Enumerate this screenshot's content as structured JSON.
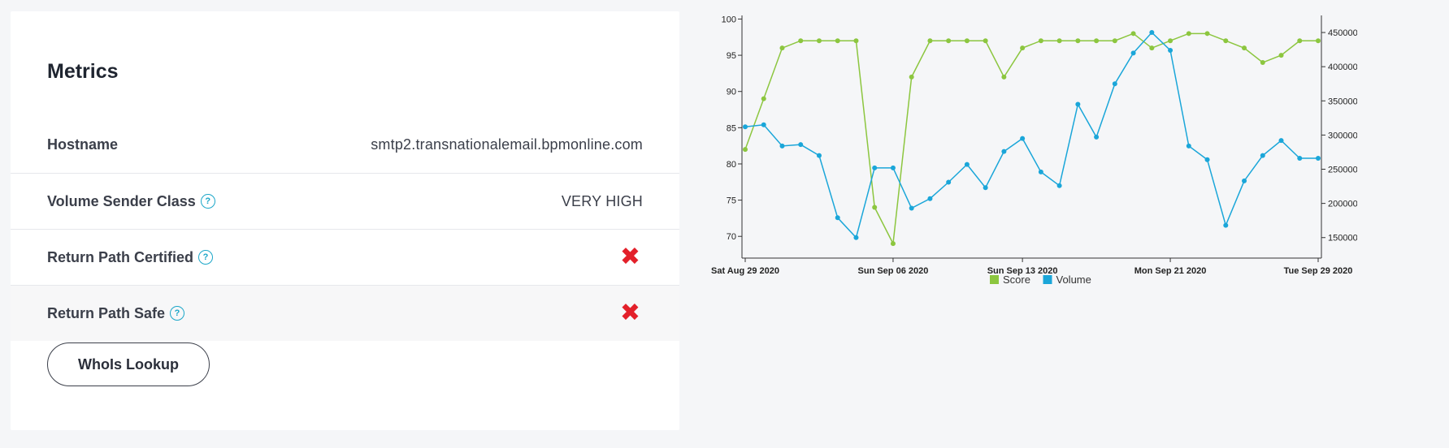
{
  "metrics": {
    "title": "Metrics",
    "rows": [
      {
        "label": "Hostname",
        "value": "smtp2.transnationalemail.bpmonline.com"
      },
      {
        "label": "Volume Sender Class",
        "value": "VERY HIGH",
        "help": "?"
      },
      {
        "label": "Return Path Certified",
        "value": "✖",
        "help": "?"
      },
      {
        "label": "Return Path Safe",
        "value": "✖",
        "help": "?"
      }
    ],
    "whois_button": "WhoIs Lookup"
  },
  "chart_data": {
    "type": "line",
    "x_labels": [
      "Sat Aug 29 2020",
      "Sun Sep 06 2020",
      "Sun Sep 13 2020",
      "Mon Sep 21 2020",
      "Tue Sep 29 2020"
    ],
    "x_label_days": [
      0,
      8,
      15,
      23,
      31
    ],
    "x_days": [
      0,
      1,
      2,
      3,
      4,
      5,
      6,
      7,
      8,
      9,
      10,
      11,
      12,
      13,
      14,
      15,
      16,
      17,
      18,
      19,
      20,
      21,
      22,
      23,
      24,
      25,
      26,
      27,
      28,
      29,
      30,
      31
    ],
    "y_left_ticks": [
      70,
      75,
      80,
      85,
      90,
      95,
      100
    ],
    "y_left_range": [
      67,
      100.5
    ],
    "y_right_ticks": [
      150000,
      200000,
      250000,
      300000,
      350000,
      400000,
      450000
    ],
    "y_right_range": [
      120000,
      475000
    ],
    "series": [
      {
        "name": "Score",
        "color": "#8cc63f",
        "axis": "left",
        "values": [
          82,
          89,
          96,
          97,
          97,
          97,
          97,
          74,
          69,
          92,
          97,
          97,
          97,
          97,
          92,
          96,
          97,
          97,
          97,
          97,
          97,
          98,
          96,
          97,
          98,
          98,
          97,
          96,
          94,
          95,
          97,
          97
        ]
      },
      {
        "name": "Volume",
        "color": "#1aa6d9",
        "axis": "right",
        "values": [
          312000,
          315000,
          284000,
          286000,
          270000,
          179000,
          150000,
          252000,
          252000,
          193000,
          207000,
          231000,
          257000,
          223000,
          276000,
          295000,
          246000,
          226000,
          345000,
          297000,
          375000,
          420000,
          450000,
          424000,
          284000,
          264000,
          168000,
          233000,
          270000,
          292000,
          266000,
          266000
        ]
      }
    ],
    "grid": false,
    "legend_position": "bottom-center"
  }
}
